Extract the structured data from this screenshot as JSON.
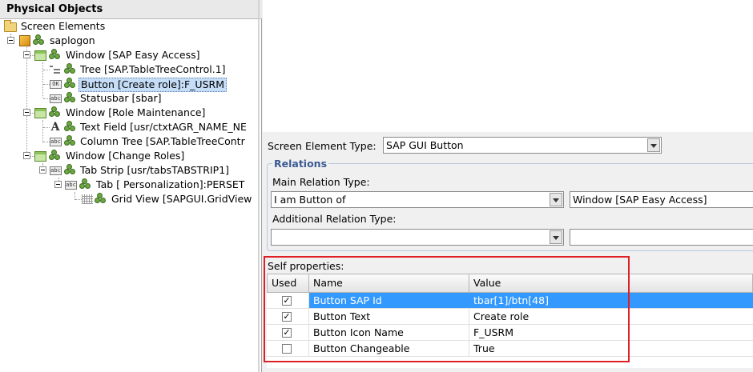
{
  "left_panel": {
    "header": "Physical Objects",
    "tree": [
      {
        "label": "Screen Elements"
      },
      {
        "label": "saplogon"
      },
      {
        "label": "Window [SAP Easy Access]"
      },
      {
        "label": "Tree [SAP.TableTreeControl.1]"
      },
      {
        "label": "Button [Create role]:F_USRM",
        "selected": true
      },
      {
        "label": "Statusbar [sbar]"
      },
      {
        "label": "Window [Role Maintenance]"
      },
      {
        "label": "Text Field [usr/ctxtAGR_NAME_NE"
      },
      {
        "label": "Column Tree [SAP.TableTreeContr"
      },
      {
        "label": "Window [Change Roles]"
      },
      {
        "label": "Tab Strip [usr/tabsTABSTRIP1]"
      },
      {
        "label": "Tab [ Personalization]:PERSET"
      },
      {
        "label": "Grid View [SAPGUI.GridView"
      }
    ],
    "icon_texts": {
      "ok": "OK",
      "abc": "abc",
      "A": "A"
    }
  },
  "right_panel": {
    "screen_element_type_label": "Screen Element Type:",
    "screen_element_type_value": "SAP GUI Button",
    "relations_title": "Relations",
    "main_relation_type_label": "Main Relation Type:",
    "main_relation_type_value": "I am Button of",
    "main_relation_target": "Window [SAP Easy Access]",
    "additional_relation_type_label": "Additional Relation Type:",
    "additional_relation_type_value": "",
    "additional_relation_target": "",
    "self_properties_label": "Self properties:",
    "grid": {
      "columns": [
        "Used",
        "Name",
        "Value"
      ],
      "rows": [
        {
          "used": true,
          "name": "Button SAP Id",
          "value": "tbar[1]/btn[48]",
          "selected": true
        },
        {
          "used": true,
          "name": "Button Text",
          "value": "Create role"
        },
        {
          "used": true,
          "name": "Button Icon Name",
          "value": "F_USRM"
        },
        {
          "used": false,
          "name": "Button Changeable",
          "value": "True"
        }
      ]
    },
    "check_glyph": "✓"
  },
  "colors": {
    "selection_blue": "#3399ff",
    "highlight_red": "#e01e26",
    "group_title": "#3b5b94"
  }
}
